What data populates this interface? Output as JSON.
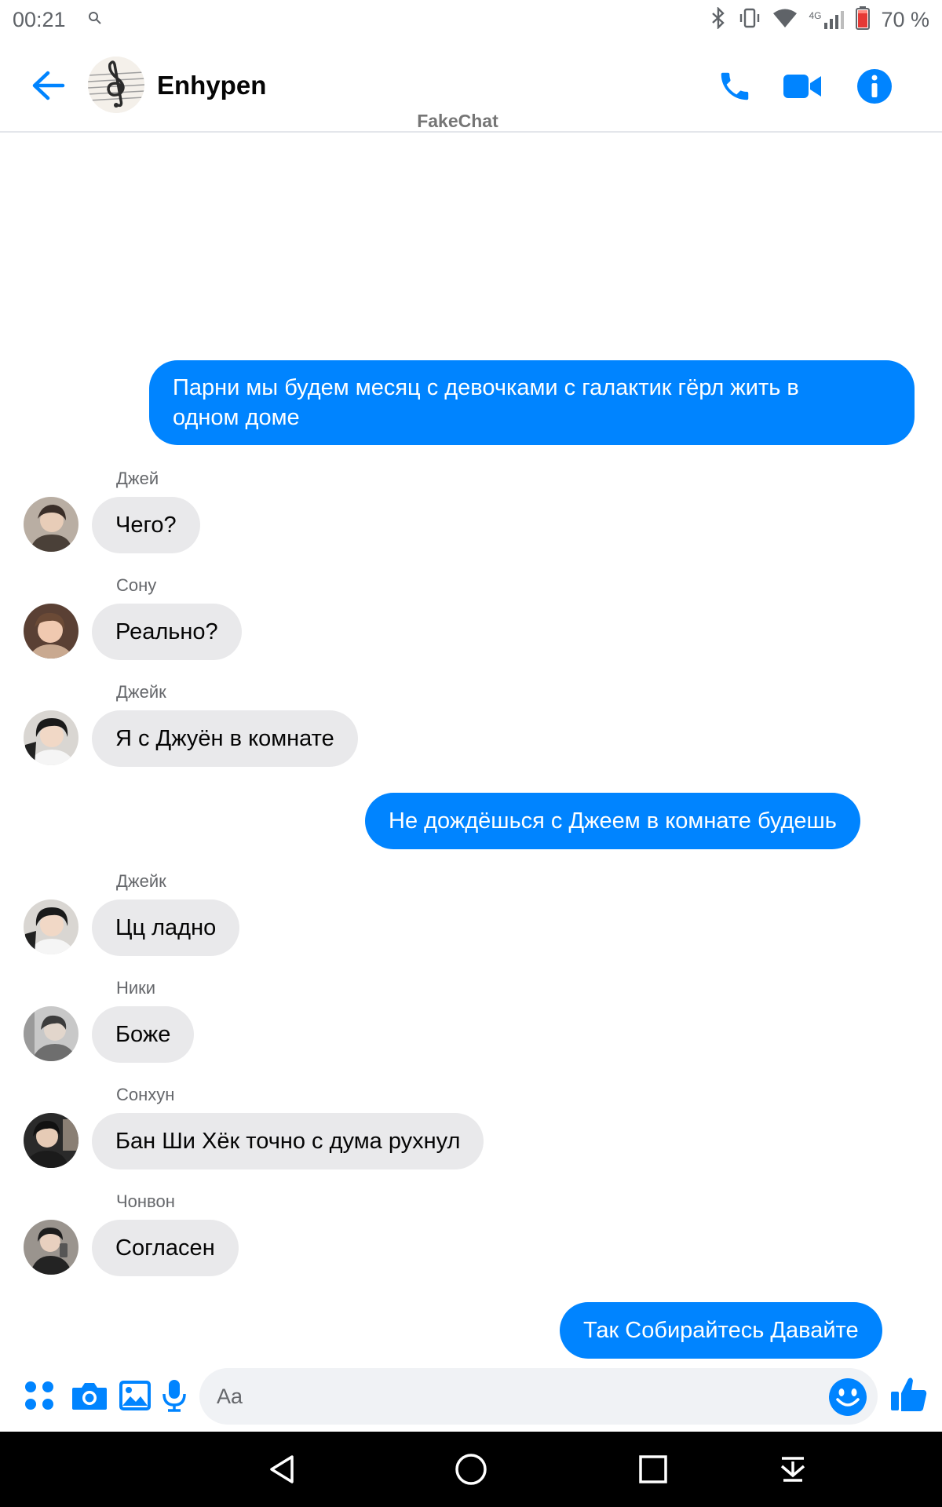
{
  "status_bar": {
    "time": "00:21",
    "network": "4G",
    "battery_text": "70 %"
  },
  "header": {
    "title": "Enhypen",
    "watermark": "FakeChat"
  },
  "messages": [
    {
      "direction": "outgoing",
      "text_lines": [
        "Парни мы будем месяц с девочками с галактик гёрл жить в",
        "одном доме"
      ]
    },
    {
      "direction": "incoming",
      "sender": "Джей",
      "text": "Чего?"
    },
    {
      "direction": "incoming",
      "sender": "Сону",
      "text": "Реально?"
    },
    {
      "direction": "incoming",
      "sender": "Джейк",
      "text": "Я с Джуён в комнате"
    },
    {
      "direction": "outgoing",
      "text": "Не дождёшься с Джеем в комнате будешь"
    },
    {
      "direction": "incoming",
      "sender": "Джейк",
      "text": "Цц ладно"
    },
    {
      "direction": "incoming",
      "sender": "Ники",
      "text": "Боже"
    },
    {
      "direction": "incoming",
      "sender": "Сонхун",
      "text": "Бан Ши Хёк точно с дума рухнул"
    },
    {
      "direction": "incoming",
      "sender": "Чонвон",
      "text": "Согласен"
    },
    {
      "direction": "outgoing",
      "text": "Так Собирайтесь Давайте"
    }
  ],
  "composer": {
    "placeholder": "Aa"
  },
  "colors": {
    "accent": "#0084ff",
    "incoming_bubble": "#e9e9eb",
    "navbar": "#000000"
  },
  "icons": [
    "back-arrow-icon",
    "phone-icon",
    "video-camera-icon",
    "info-icon",
    "apps-grid-icon",
    "camera-icon",
    "gallery-icon",
    "microphone-icon",
    "emoji-icon",
    "thumbs-up-icon",
    "nav-back-icon",
    "nav-home-icon",
    "nav-recents-icon",
    "nav-notifications-icon"
  ]
}
